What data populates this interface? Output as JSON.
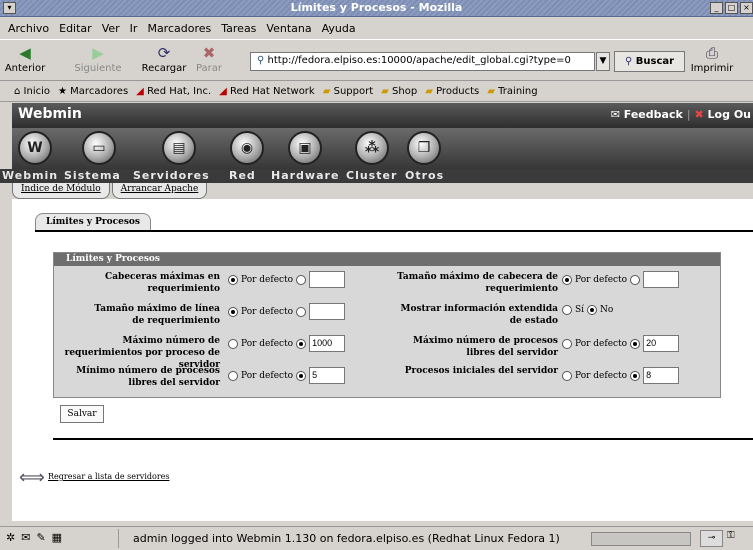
{
  "window": {
    "title": "Límites y Procesos - Mozilla",
    "buttons": [
      "_",
      "□",
      "×"
    ]
  },
  "menu": [
    "Archivo",
    "Editar",
    "Ver",
    "Ir",
    "Marcadores",
    "Tareas",
    "Ventana",
    "Ayuda"
  ],
  "nav": {
    "back": "Anterior",
    "forward": "Siguiente",
    "reload": "Recargar",
    "stop": "Parar",
    "url": "http://fedora.elpiso.es:10000/apache/edit_global.cgi?type=0",
    "search": "Buscar",
    "print": "Imprimir"
  },
  "bookmarks": [
    "Inicio",
    "Marcadores",
    "Red Hat, Inc.",
    "Red Hat Network",
    "Support",
    "Shop",
    "Products",
    "Training"
  ],
  "webmin": {
    "logo": "Webmin",
    "feedback": "Feedback",
    "logout": "Log Ou",
    "categories": [
      "Webmin",
      "Sistema",
      "Servidores",
      "Red",
      "Hardware",
      "Cluster",
      "Otros"
    ]
  },
  "subtabs": [
    "Indice de Módulo",
    "Arrancar Apache"
  ],
  "page": {
    "tab": "Límites y Procesos",
    "form_title": "Límites y Procesos",
    "default_label": "Por defecto",
    "yes": "Sí",
    "no": "No",
    "fields": {
      "max_headers_label": "Cabeceras máximas en requerimiento",
      "max_header_size_label": "Tamaño máximo de cabecera de requerimiento",
      "max_line_size_label": "Tamaño máximo de línea de requerimiento",
      "extended_status_label": "Mostrar información extendida de estado",
      "max_requests_label": "Máximo número de requerimientos por proceso de servidor",
      "max_requests_value": "1000",
      "max_spare_label": "Máximo número de procesos libres del servidor",
      "max_spare_value": "20",
      "min_spare_label": "Mínimo número de procesos libres del servidor",
      "min_spare_value": "5",
      "start_servers_label": "Procesos iniciales del servidor",
      "start_servers_value": "8"
    },
    "save": "Salvar",
    "back_link": "Regresar a lista de servidores"
  },
  "status": {
    "message": "admin logged into Webmin 1.130 on fedora.elpiso.es (Redhat Linux Fedora 1)"
  }
}
